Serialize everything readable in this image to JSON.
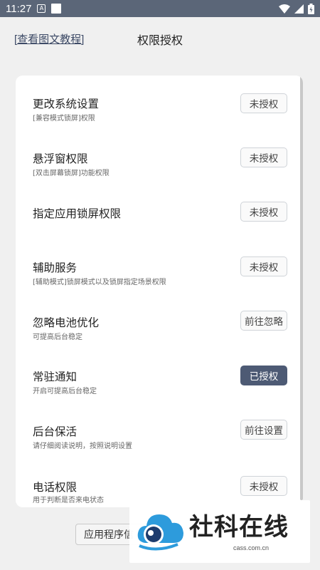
{
  "status_bar": {
    "time": "11:27",
    "badge": "A"
  },
  "header": {
    "tutorial_link": "[查看图文教程]",
    "title": "权限授权"
  },
  "permissions": [
    {
      "title": "更改系统设置",
      "subtitle": "[兼容模式锁屏]权限",
      "button": "未授权",
      "granted": false
    },
    {
      "title": "悬浮窗权限",
      "subtitle": "[双击屏幕锁屏]功能权限",
      "button": "未授权",
      "granted": false
    },
    {
      "title": "指定应用锁屏权限",
      "subtitle": "",
      "button": "未授权",
      "granted": false
    },
    {
      "title": "辅助服务",
      "subtitle": "[辅助模式]锁屏模式以及锁屏指定场景权限",
      "button": "未授权",
      "granted": false
    },
    {
      "title": "忽略电池优化",
      "subtitle": "可提高后台稳定",
      "button": "前往忽略",
      "granted": false
    },
    {
      "title": "常驻通知",
      "subtitle": "开启可提高后台稳定",
      "button": "已授权",
      "granted": true
    },
    {
      "title": "后台保活",
      "subtitle": "请仔细阅读说明，按照说明设置",
      "button": "前往设置",
      "granted": false
    },
    {
      "title": "电话权限",
      "subtitle": "用于判断是否来电状态",
      "button": "未授权",
      "granted": false
    }
  ],
  "bottom_button": "应用程序信",
  "watermark": {
    "text": "社科在线",
    "url": "cass.com.cn"
  },
  "colors": {
    "status_bar": "#5b6678",
    "accent": "#4d5a74",
    "background": "#f0f0f0"
  }
}
